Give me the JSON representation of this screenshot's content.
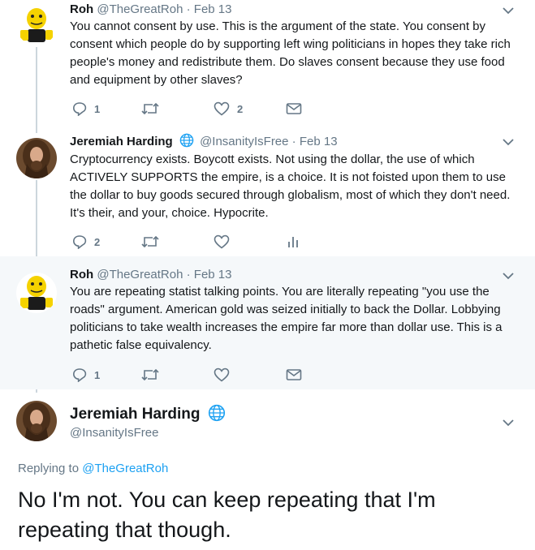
{
  "tweets": [
    {
      "name": "Roh",
      "handle": "@TheGreatRoh",
      "date": "Feb 13",
      "text": "You cannot consent by use. This is the argument of the state. You consent by consent which people do by supporting left wing politicians in hopes they take rich people's money and redistribute them. Do slaves consent because they use food and equipment by other slaves?",
      "replies": "1",
      "retweets": "",
      "likes": "2"
    },
    {
      "name": "Jeremiah Harding",
      "handle": "@InsanityIsFree",
      "date": "Feb 13",
      "text": "Cryptocurrency exists. Boycott exists. Not using the dollar, the use of which ACTIVELY SUPPORTS the empire, is a choice. It is not foisted upon them to use the dollar to buy goods secured through globalism, most of which they don't need. It's their, and your, choice. Hypocrite.",
      "replies": "2",
      "retweets": "",
      "likes": ""
    },
    {
      "name": "Roh",
      "handle": "@TheGreatRoh",
      "date": "Feb 13",
      "text": "You are repeating statist talking points. You are literally repeating \"you use the roads\" argument. American gold was seized initially to back the Dollar. Lobbying politicians to take wealth increases the empire far more than dollar use. This is a pathetic false equivalency.",
      "replies": "1",
      "retweets": "",
      "likes": ""
    }
  ],
  "main_tweet": {
    "name": "Jeremiah Harding",
    "handle": "@InsanityIsFree",
    "replying_prefix": "Replying to",
    "replying_to": "@TheGreatRoh",
    "text": "No I'm not. You can keep repeating that I'm repeating that though."
  },
  "separator": "·",
  "colors": {
    "text": "#14171a",
    "muted": "#657786",
    "accent": "#1da1f2",
    "thread_line": "#ccd6dd",
    "highlight_bg": "#f5f8fa"
  },
  "icons": [
    "reply-icon",
    "retweet-icon",
    "like-icon",
    "message-icon",
    "analytics-icon",
    "globe-icon",
    "chevron-down-icon"
  ]
}
